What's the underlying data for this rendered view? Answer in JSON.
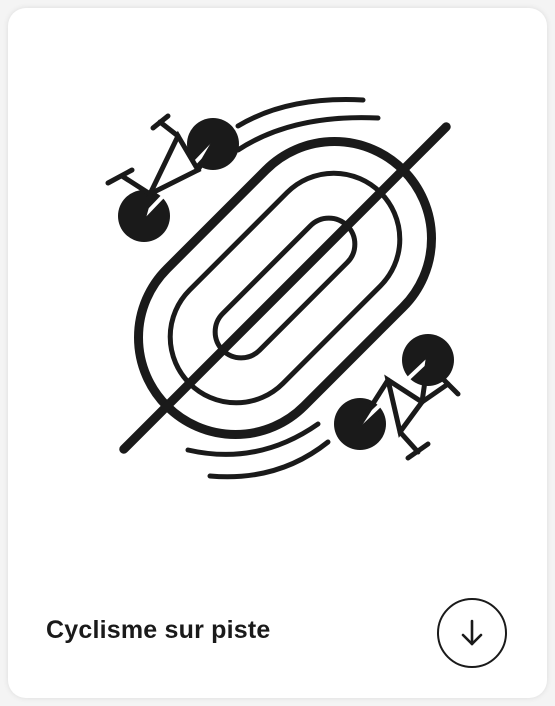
{
  "card": {
    "title": "Cyclisme sur piste",
    "pictogram_icon": "track-cycling-pictogram",
    "download_icon": "download-arrow-icon"
  },
  "colors": {
    "ink": "#1a1a1a",
    "card_background": "#ffffff",
    "page_background": "#f4f4f4"
  }
}
